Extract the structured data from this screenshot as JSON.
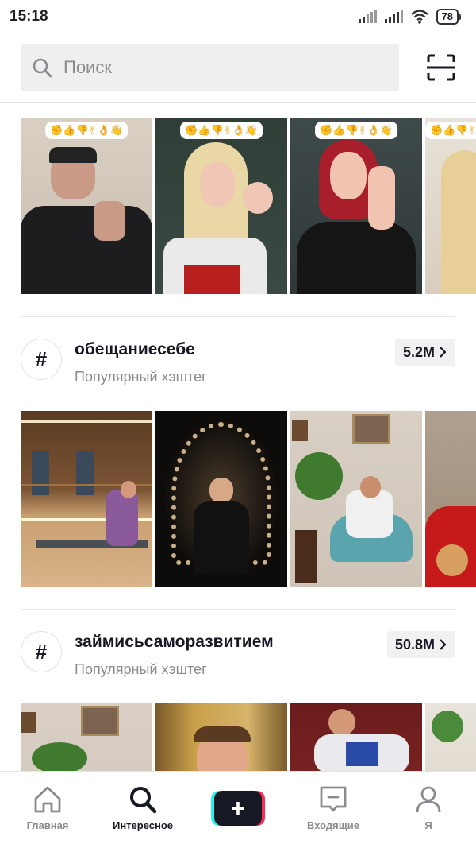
{
  "status": {
    "time": "15:18",
    "battery": "78"
  },
  "search": {
    "placeholder": "Поиск"
  },
  "sections": [
    {
      "title": "обещаниесебе",
      "subtitle": "Популярный хэштег",
      "count": "5.2M"
    },
    {
      "title": "займисьсаморазвитием",
      "subtitle": "Популярный хэштег",
      "count": "50.8M"
    }
  ],
  "emoji_strip": "✊👍👎✌👌👋",
  "nav": {
    "home": "Главная",
    "discover": "Интересное",
    "inbox": "Входящие",
    "me": "Я"
  },
  "colors": {
    "accent_cyan": "#25f4ee",
    "accent_red": "#fe2c55",
    "text_primary": "#161823",
    "text_secondary": "#8a8b91"
  }
}
